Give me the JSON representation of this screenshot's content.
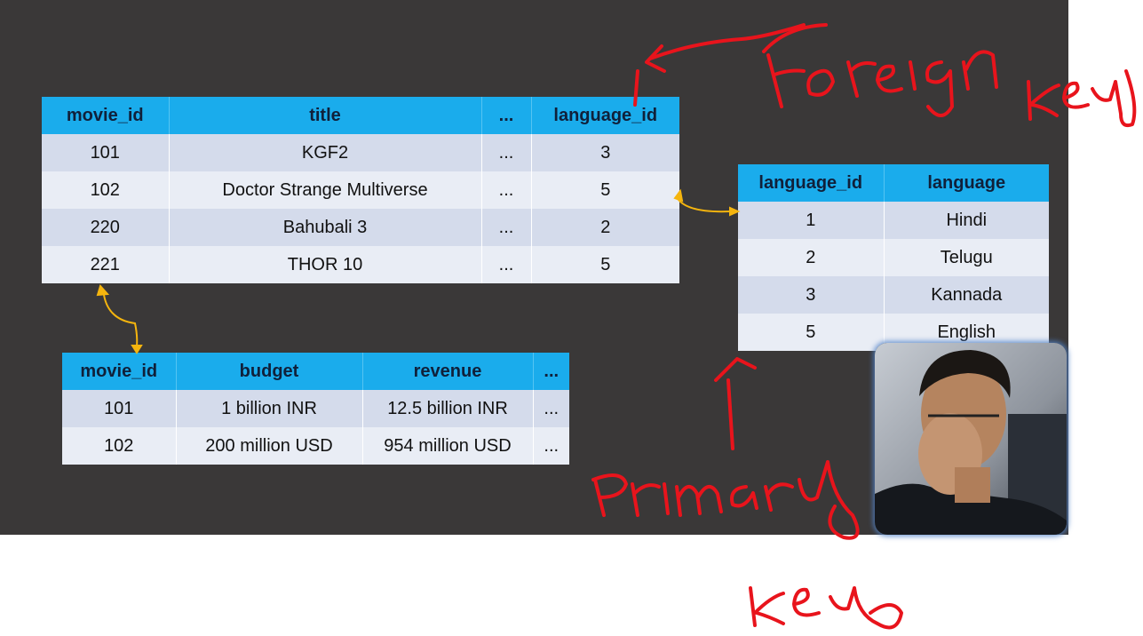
{
  "movies_table": {
    "headers": [
      "movie_id",
      "title",
      "...",
      "language_id"
    ],
    "rows": [
      [
        "101",
        "KGF2",
        "...",
        "3"
      ],
      [
        "102",
        "Doctor Strange Multiverse",
        "...",
        "5"
      ],
      [
        "220",
        "Bahubali 3",
        "...",
        "2"
      ],
      [
        "221",
        "THOR 10",
        "...",
        "5"
      ]
    ]
  },
  "languages_table": {
    "headers": [
      "language_id",
      "language"
    ],
    "rows": [
      [
        "1",
        "Hindi"
      ],
      [
        "2",
        "Telugu"
      ],
      [
        "3",
        "Kannada"
      ],
      [
        "5",
        "English"
      ]
    ]
  },
  "finance_table": {
    "headers": [
      "movie_id",
      "budget",
      "revenue",
      "..."
    ],
    "rows": [
      [
        "101",
        "1 billion INR",
        "12.5 billion INR",
        "..."
      ],
      [
        "102",
        "200 million USD",
        "954 million USD",
        "..."
      ]
    ]
  },
  "annotations": {
    "foreign_key": "Foreign key",
    "primary_key": "Primary key"
  },
  "colors": {
    "slide_background": "#3a3838",
    "table_header": "#1aacec",
    "row_odd": "#d4dbeb",
    "row_even": "#e9edf5",
    "relation_arrow": "#f5b50e",
    "ink": "#e8141c"
  }
}
